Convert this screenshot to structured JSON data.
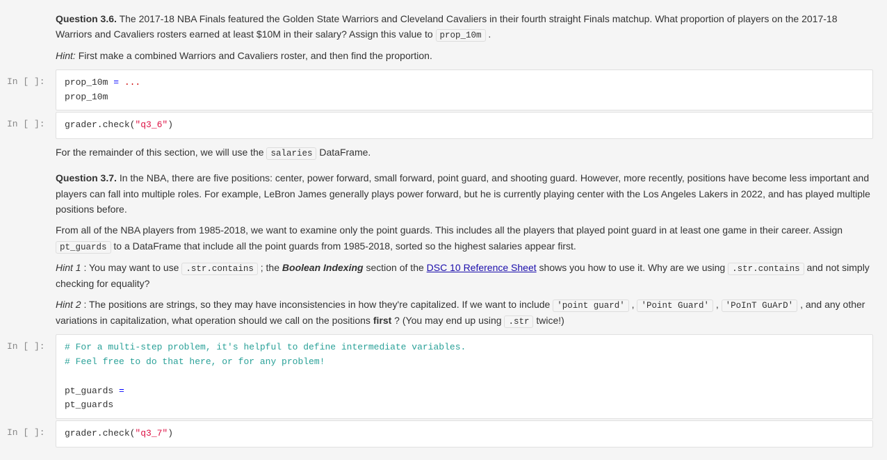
{
  "cells": [
    {
      "type": "markdown",
      "id": "q36-text",
      "content": [
        {
          "tag": "p",
          "parts": [
            {
              "type": "bold",
              "text": "Question 3.6."
            },
            {
              "type": "text",
              "text": " The 2017-18 NBA Finals featured the Golden State Warriors and Cleveland Cavaliers in their fourth straight Finals matchup. What proportion of players on the 2017-18 Warriors and Cavaliers rosters earned at least $10M in their salary? Assign this value to "
            },
            {
              "type": "code",
              "text": "prop_10m"
            },
            {
              "type": "text",
              "text": "."
            }
          ]
        },
        {
          "tag": "p",
          "parts": [
            {
              "type": "italic",
              "text": "Hint:"
            },
            {
              "type": "text",
              "text": " First make a combined Warriors and Cavaliers roster, and then find the proportion."
            }
          ]
        }
      ]
    },
    {
      "type": "code",
      "label": "In [ ]:",
      "lines": [
        {
          "parts": [
            {
              "type": "plain",
              "text": "prop_10m "
            },
            {
              "type": "kw-blue",
              "text": "="
            },
            {
              "type": "kw-red",
              "text": " ..."
            }
          ]
        },
        {
          "parts": [
            {
              "type": "plain",
              "text": "prop_10m"
            }
          ]
        }
      ]
    },
    {
      "type": "code",
      "label": "In [ ]:",
      "lines": [
        {
          "parts": [
            {
              "type": "plain",
              "text": "grader.check("
            },
            {
              "type": "kw-string",
              "text": "\"q3_6\""
            },
            {
              "type": "plain",
              "text": ")"
            }
          ]
        }
      ]
    },
    {
      "type": "markdown",
      "id": "salaries-text",
      "content_raw": "For the remainder of this section, we will use the salaries DataFrame."
    },
    {
      "type": "markdown",
      "id": "q37-text"
    },
    {
      "type": "code",
      "label": "In [ ]:",
      "lines": [
        {
          "parts": [
            {
              "type": "kw-comment",
              "text": "# For a multi-step problem, it's helpful to define intermediate variables."
            }
          ]
        },
        {
          "parts": [
            {
              "type": "kw-comment",
              "text": "# Feel free to do that here, or for any problem!"
            }
          ]
        },
        {
          "parts": []
        },
        {
          "parts": [
            {
              "type": "plain",
              "text": "pt_guards "
            },
            {
              "type": "kw-blue",
              "text": "="
            }
          ]
        },
        {
          "parts": [
            {
              "type": "plain",
              "text": "pt_guards"
            }
          ]
        }
      ]
    },
    {
      "type": "code",
      "label": "In [ ]:",
      "lines": [
        {
          "parts": [
            {
              "type": "plain",
              "text": "grader.check("
            },
            {
              "type": "kw-string",
              "text": "\"q3_7\""
            },
            {
              "type": "plain",
              "text": ")"
            }
          ]
        }
      ]
    }
  ],
  "links": {
    "dsc10_ref": "DSC 10 Reference Sheet"
  }
}
